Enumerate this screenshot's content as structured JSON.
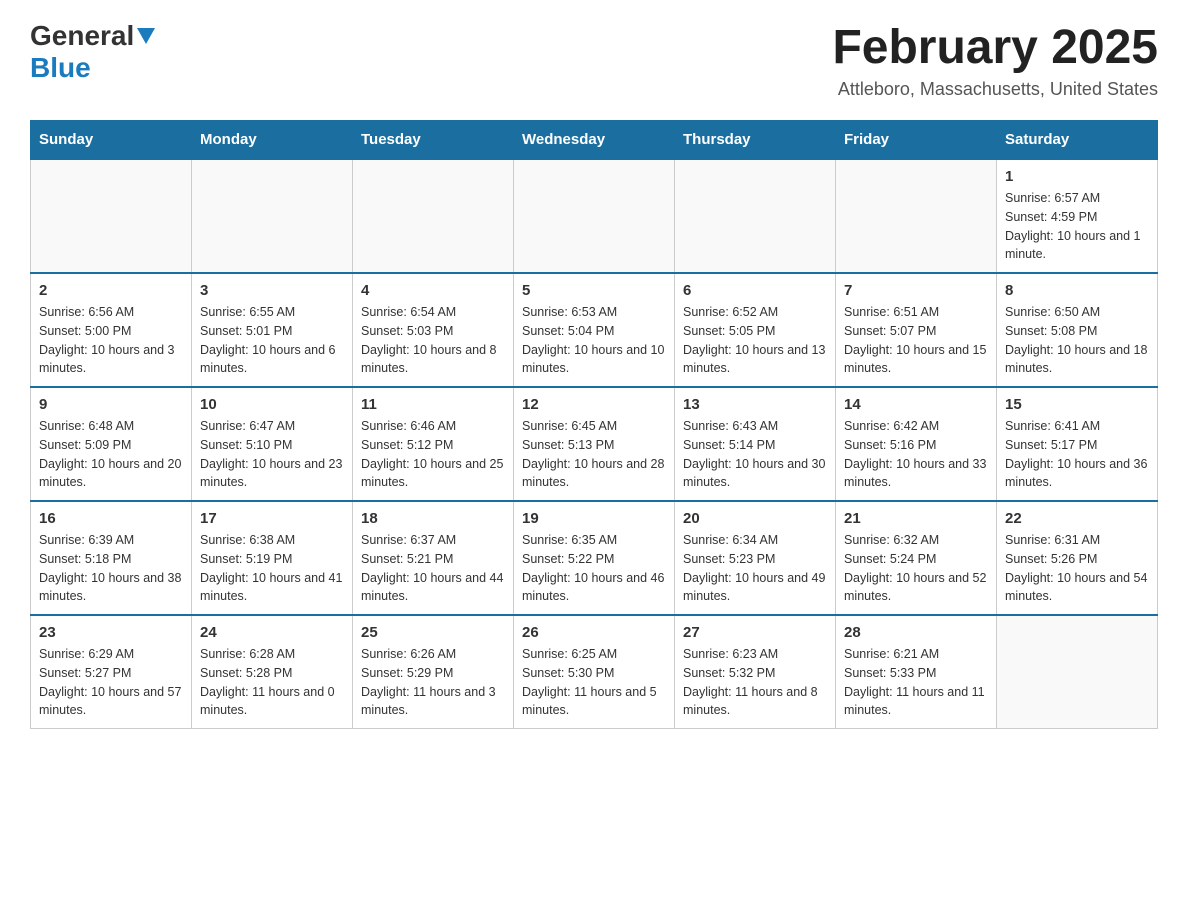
{
  "header": {
    "logo_general": "General",
    "logo_blue": "Blue",
    "title": "February 2025",
    "subtitle": "Attleboro, Massachusetts, United States"
  },
  "days_of_week": [
    "Sunday",
    "Monday",
    "Tuesday",
    "Wednesday",
    "Thursday",
    "Friday",
    "Saturday"
  ],
  "weeks": [
    [
      {
        "day": "",
        "info": ""
      },
      {
        "day": "",
        "info": ""
      },
      {
        "day": "",
        "info": ""
      },
      {
        "day": "",
        "info": ""
      },
      {
        "day": "",
        "info": ""
      },
      {
        "day": "",
        "info": ""
      },
      {
        "day": "1",
        "info": "Sunrise: 6:57 AM\nSunset: 4:59 PM\nDaylight: 10 hours and 1 minute."
      }
    ],
    [
      {
        "day": "2",
        "info": "Sunrise: 6:56 AM\nSunset: 5:00 PM\nDaylight: 10 hours and 3 minutes."
      },
      {
        "day": "3",
        "info": "Sunrise: 6:55 AM\nSunset: 5:01 PM\nDaylight: 10 hours and 6 minutes."
      },
      {
        "day": "4",
        "info": "Sunrise: 6:54 AM\nSunset: 5:03 PM\nDaylight: 10 hours and 8 minutes."
      },
      {
        "day": "5",
        "info": "Sunrise: 6:53 AM\nSunset: 5:04 PM\nDaylight: 10 hours and 10 minutes."
      },
      {
        "day": "6",
        "info": "Sunrise: 6:52 AM\nSunset: 5:05 PM\nDaylight: 10 hours and 13 minutes."
      },
      {
        "day": "7",
        "info": "Sunrise: 6:51 AM\nSunset: 5:07 PM\nDaylight: 10 hours and 15 minutes."
      },
      {
        "day": "8",
        "info": "Sunrise: 6:50 AM\nSunset: 5:08 PM\nDaylight: 10 hours and 18 minutes."
      }
    ],
    [
      {
        "day": "9",
        "info": "Sunrise: 6:48 AM\nSunset: 5:09 PM\nDaylight: 10 hours and 20 minutes."
      },
      {
        "day": "10",
        "info": "Sunrise: 6:47 AM\nSunset: 5:10 PM\nDaylight: 10 hours and 23 minutes."
      },
      {
        "day": "11",
        "info": "Sunrise: 6:46 AM\nSunset: 5:12 PM\nDaylight: 10 hours and 25 minutes."
      },
      {
        "day": "12",
        "info": "Sunrise: 6:45 AM\nSunset: 5:13 PM\nDaylight: 10 hours and 28 minutes."
      },
      {
        "day": "13",
        "info": "Sunrise: 6:43 AM\nSunset: 5:14 PM\nDaylight: 10 hours and 30 minutes."
      },
      {
        "day": "14",
        "info": "Sunrise: 6:42 AM\nSunset: 5:16 PM\nDaylight: 10 hours and 33 minutes."
      },
      {
        "day": "15",
        "info": "Sunrise: 6:41 AM\nSunset: 5:17 PM\nDaylight: 10 hours and 36 minutes."
      }
    ],
    [
      {
        "day": "16",
        "info": "Sunrise: 6:39 AM\nSunset: 5:18 PM\nDaylight: 10 hours and 38 minutes."
      },
      {
        "day": "17",
        "info": "Sunrise: 6:38 AM\nSunset: 5:19 PM\nDaylight: 10 hours and 41 minutes."
      },
      {
        "day": "18",
        "info": "Sunrise: 6:37 AM\nSunset: 5:21 PM\nDaylight: 10 hours and 44 minutes."
      },
      {
        "day": "19",
        "info": "Sunrise: 6:35 AM\nSunset: 5:22 PM\nDaylight: 10 hours and 46 minutes."
      },
      {
        "day": "20",
        "info": "Sunrise: 6:34 AM\nSunset: 5:23 PM\nDaylight: 10 hours and 49 minutes."
      },
      {
        "day": "21",
        "info": "Sunrise: 6:32 AM\nSunset: 5:24 PM\nDaylight: 10 hours and 52 minutes."
      },
      {
        "day": "22",
        "info": "Sunrise: 6:31 AM\nSunset: 5:26 PM\nDaylight: 10 hours and 54 minutes."
      }
    ],
    [
      {
        "day": "23",
        "info": "Sunrise: 6:29 AM\nSunset: 5:27 PM\nDaylight: 10 hours and 57 minutes."
      },
      {
        "day": "24",
        "info": "Sunrise: 6:28 AM\nSunset: 5:28 PM\nDaylight: 11 hours and 0 minutes."
      },
      {
        "day": "25",
        "info": "Sunrise: 6:26 AM\nSunset: 5:29 PM\nDaylight: 11 hours and 3 minutes."
      },
      {
        "day": "26",
        "info": "Sunrise: 6:25 AM\nSunset: 5:30 PM\nDaylight: 11 hours and 5 minutes."
      },
      {
        "day": "27",
        "info": "Sunrise: 6:23 AM\nSunset: 5:32 PM\nDaylight: 11 hours and 8 minutes."
      },
      {
        "day": "28",
        "info": "Sunrise: 6:21 AM\nSunset: 5:33 PM\nDaylight: 11 hours and 11 minutes."
      },
      {
        "day": "",
        "info": ""
      }
    ]
  ]
}
